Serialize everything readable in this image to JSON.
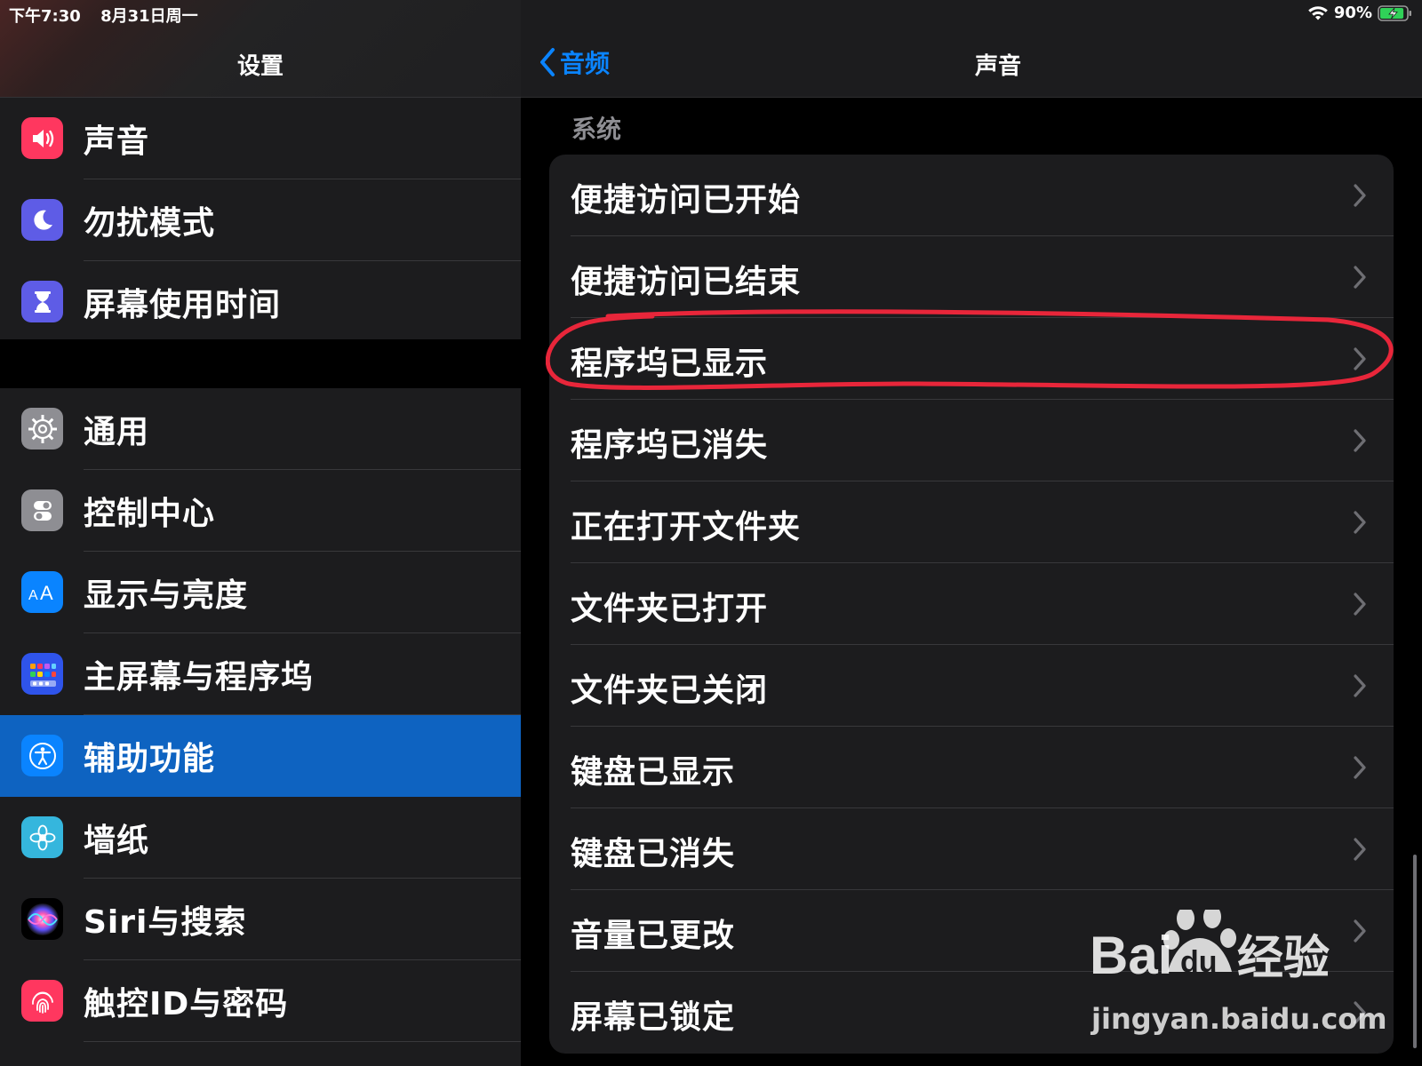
{
  "status_bar": {
    "time": "下午7:30",
    "date": "8月31日周一",
    "battery_percent": "90%",
    "battery_level": 0.9,
    "charging": true
  },
  "sidebar": {
    "title": "设置",
    "groups": [
      [
        {
          "label": "声音",
          "icon": "speaker-icon",
          "color": "#ff375f"
        },
        {
          "label": "勿扰模式",
          "icon": "moon-icon",
          "color": "#5e5ce6"
        },
        {
          "label": "屏幕使用时间",
          "icon": "hourglass-icon",
          "color": "#5e5ce6"
        }
      ],
      [
        {
          "label": "通用",
          "icon": "gear-icon",
          "color": "#8e8e93"
        },
        {
          "label": "控制中心",
          "icon": "toggles-icon",
          "color": "#8e8e93"
        },
        {
          "label": "显示与亮度",
          "icon": "text-size-icon",
          "color": "#0a84ff"
        },
        {
          "label": "主屏幕与程序坞",
          "icon": "app-grid-icon",
          "color": "#2f54eb"
        },
        {
          "label": "辅助功能",
          "icon": "accessibility-icon",
          "color": "#0a84ff",
          "selected": true
        },
        {
          "label": "墙纸",
          "icon": "flower-icon",
          "color": "#35b6dd"
        },
        {
          "label": "Siri与搜索",
          "icon": "siri-icon",
          "color": "#1c1c1e"
        },
        {
          "label": "触控ID与密码",
          "icon": "fingerprint-icon",
          "color": "#ff375f"
        }
      ]
    ]
  },
  "detail": {
    "back_label": "音频",
    "title": "声音",
    "section_header": "系统",
    "items": [
      "便捷访问已开始",
      "便捷访问已结束",
      "程序坞已显示",
      "程序坞已消失",
      "正在打开文件夹",
      "文件夹已打开",
      "文件夹已关闭",
      "键盘已显示",
      "键盘已消失",
      "音量已更改",
      "屏幕已锁定"
    ],
    "highlighted_item": "程序坞已显示",
    "highlight_color": "#e8263a"
  },
  "watermark": {
    "brand": "Bai经验",
    "url": "jingyan.baidu.com"
  }
}
